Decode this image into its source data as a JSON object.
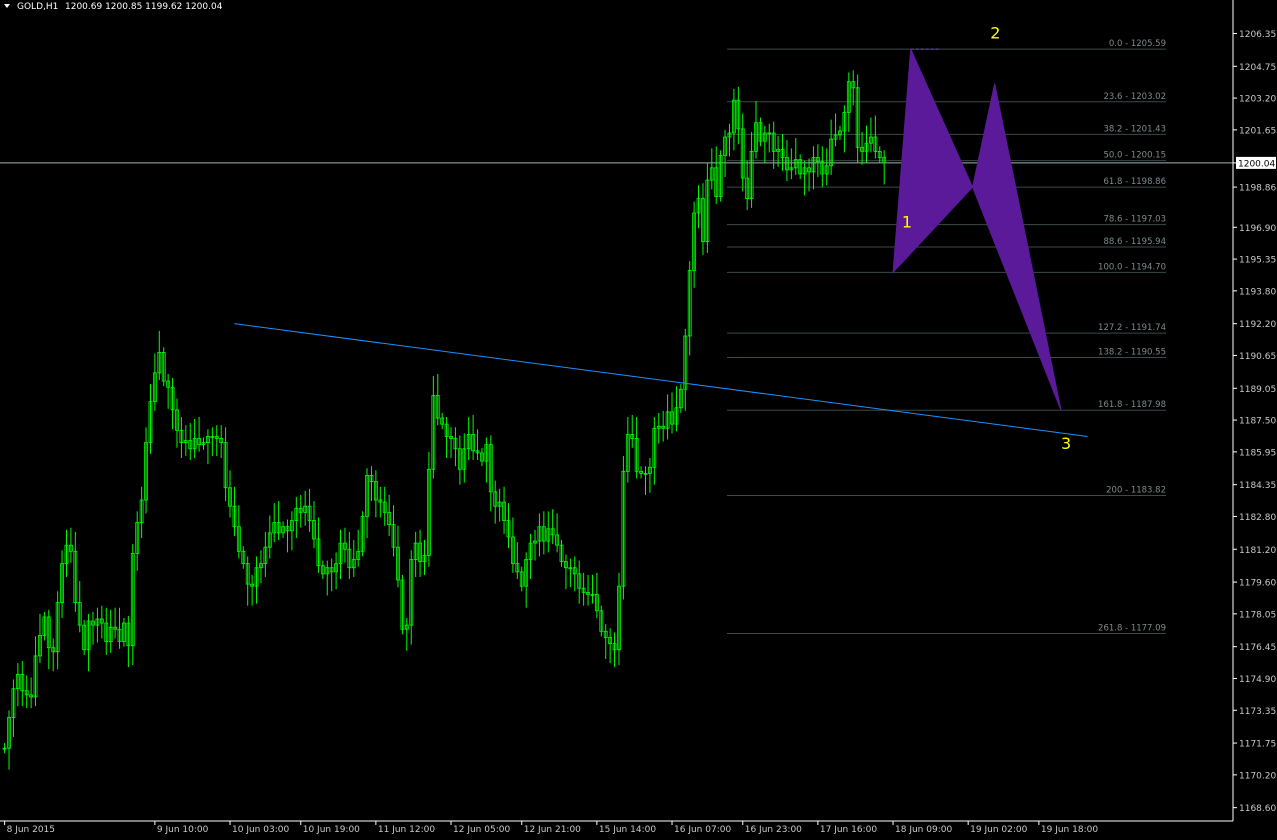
{
  "header": {
    "symbol": "GOLD,H1",
    "ohlc": "1200.69 1200.85 1199.62 1200.04",
    "menu_icon": "triangle-down-icon"
  },
  "colors": {
    "background": "#000000",
    "candle": "#00ff00",
    "axis": "#ffffff",
    "fib": "#3a4a4a",
    "trendline": "#1e90ff",
    "pattern_fill": "#5b1a99",
    "current_price_line": "#a0b4b4",
    "wave_labels": "#ffff00"
  },
  "chart_data": {
    "type": "candlestick",
    "symbol": "GOLD",
    "timeframe": "H1",
    "ylim": [
      1167.95,
      1207.3
    ],
    "y_ticks": [
      "1206.35",
      "1204.75",
      "1203.20",
      "1201.65",
      "1200.04",
      "1198.86",
      "1196.90",
      "1195.35",
      "1193.80",
      "1192.20",
      "1190.65",
      "1189.05",
      "1187.50",
      "1185.95",
      "1184.35",
      "1182.80",
      "1181.20",
      "1179.60",
      "1178.05",
      "1176.45",
      "1174.90",
      "1173.35",
      "1171.75",
      "1170.20",
      "1168.60"
    ],
    "x_ticks": [
      "8 Jun 2015",
      "9 Jun 10:00",
      "10 Jun 03:00",
      "10 Jun 19:00",
      "11 Jun 12:00",
      "12 Jun 05:00",
      "12 Jun 21:00",
      "15 Jun 14:00",
      "16 Jun 07:00",
      "16 Jun 23:00",
      "17 Jun 16:00",
      "18 Jun 09:00",
      "19 Jun 02:00",
      "19 Jun 18:00"
    ],
    "current_price": 1200.04,
    "close_series": [
      1171.5,
      1173.0,
      1174.4,
      1175.1,
      1174.3,
      1174.1,
      1174.0,
      1176.0,
      1177.0,
      1177.9,
      1176.4,
      1176.2,
      1178.6,
      1180.5,
      1181.4,
      1181.1,
      1178.6,
      1177.5,
      1176.3,
      1177.7,
      1177.5,
      1177.8,
      1177.6,
      1176.7,
      1177.4,
      1177.3,
      1176.7,
      1177.6,
      1176.5,
      1181.0,
      1182.5,
      1183.6,
      1186.4,
      1188.4,
      1189.8,
      1190.8,
      1189.4,
      1189.1,
      1188.0,
      1187.0,
      1186.4,
      1186.5,
      1186.1,
      1186.6,
      1186.3,
      1186.4,
      1186.7,
      1186.7,
      1186.6,
      1186.4,
      1184.2,
      1183.3,
      1182.3,
      1181.1,
      1180.5,
      1179.5,
      1179.4,
      1180.3,
      1180.5,
      1181.3,
      1182.0,
      1182.5,
      1182.0,
      1182.3,
      1182.1,
      1182.6,
      1183.2,
      1183.0,
      1183.3,
      1182.6,
      1181.7,
      1180.4,
      1180.0,
      1180.3,
      1180.1,
      1180.5,
      1181.5,
      1181.2,
      1180.3,
      1180.7,
      1181.1,
      1182.8,
      1184.8,
      1184.5,
      1183.6,
      1183.5,
      1183.0,
      1182.4,
      1181.3,
      1179.7,
      1177.3,
      1177.5,
      1180.7,
      1181.5,
      1180.6,
      1180.9,
      1185.1,
      1188.7,
      1187.6,
      1187.3,
      1186.7,
      1186.6,
      1186.1,
      1185.1,
      1186.1,
      1186.8,
      1186.0,
      1185.9,
      1185.5,
      1186.3,
      1184.0,
      1183.3,
      1183.5,
      1182.6,
      1181.8,
      1180.5,
      1180.1,
      1179.4,
      1180.7,
      1181.5,
      1181.6,
      1182.3,
      1181.6,
      1182.2,
      1181.9,
      1181.4,
      1180.6,
      1180.3,
      1180.3,
      1180.0,
      1179.3,
      1179.1,
      1179.0,
      1179.0,
      1178.2,
      1177.2,
      1176.9,
      1176.6,
      1176.3,
      1179.4,
      1185.0,
      1186.8,
      1186.6,
      1185.0,
      1184.9,
      1184.9,
      1185.2,
      1187.1,
      1187.2,
      1187.1,
      1187.9,
      1187.3,
      1188.1,
      1189.0,
      1191.6,
      1194.8,
      1197.6,
      1198.3,
      1196.2,
      1199.2,
      1199.8,
      1198.4,
      1200.4,
      1201.3,
      1201.5,
      1203.1,
      1201.7,
      1199.3,
      1198.3,
      1200.6,
      1202.0,
      1201.1,
      1201.5,
      1201.5,
      1200.6,
      1200.7,
      1200.3,
      1199.7,
      1199.8,
      1200.2,
      1199.5,
      1199.8,
      1199.6,
      1200.3,
      1200.1,
      1199.5,
      1199.9,
      1201.2,
      1201.4,
      1201.6,
      1202.5,
      1204.0,
      1203.7,
      1200.8,
      1200.6,
      1201.0,
      1201.3,
      1200.6,
      1200.3,
      1200.04
    ],
    "fibonacci": [
      {
        "label": "0.0 - 1205.59",
        "price": 1205.59
      },
      {
        "label": "23.6  - 1203.02",
        "price": 1203.02
      },
      {
        "label": "38.2 - 1201.43",
        "price": 1201.43
      },
      {
        "label": "50.0 - 1200.15",
        "price": 1200.15
      },
      {
        "label": "61.8 - 1198.86",
        "price": 1198.86
      },
      {
        "label": "78.6 - 1197.03",
        "price": 1197.03
      },
      {
        "label": "88.6 - 1195.94",
        "price": 1195.94
      },
      {
        "label": "100.0 - 1194.70",
        "price": 1194.7
      },
      {
        "label": "127.2 - 1191.74",
        "price": 1191.74
      },
      {
        "label": "138.2 - 1190.55",
        "price": 1190.55
      },
      {
        "label": "161.8 - 1187.98",
        "price": 1187.98
      },
      {
        "label": "200 - 1183.82",
        "price": 1183.82
      },
      {
        "label": "261.8 - 1177.09",
        "price": 1177.09
      }
    ],
    "trendline": {
      "from": {
        "date": "10 Jun 04:00",
        "price": 1192.2
      },
      "to": {
        "date": "22 Jun 05:00",
        "price": 1186.7
      }
    },
    "pattern": {
      "x": {
        "date": "18 Jun 09:00",
        "price": 1194.7
      },
      "a": {
        "date": "18 Jun 13:00",
        "price": 1205.59
      },
      "b": {
        "date": "19 Jun 03:00",
        "price": 1198.86
      },
      "c": {
        "date": "19 Jun 08:00",
        "price": 1203.9
      },
      "d": {
        "date": "19 Jun 23:00",
        "price": 1187.98
      }
    },
    "wave_labels": [
      {
        "text": "1",
        "date": "18 Jun 11:00",
        "price": 1196.9
      },
      {
        "text": "2",
        "date": "19 Jun 07:00",
        "price": 1206.1
      },
      {
        "text": "3",
        "date": "19 Jun 23:00",
        "price": 1186.1
      }
    ]
  }
}
